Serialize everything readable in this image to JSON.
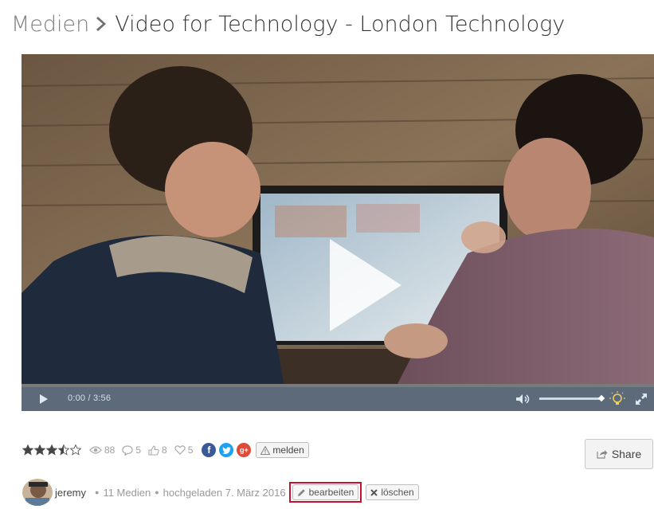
{
  "breadcrumb": {
    "parent": "Medien",
    "current": "Video for Technology - London Technology"
  },
  "player": {
    "time_display": "0:00 / 3:56",
    "progress": 0,
    "volume_level": 1.0
  },
  "stats": {
    "rating": 3.5,
    "rating_max": 5,
    "views": "88",
    "comments": "5",
    "likes": "8",
    "favorites": "5"
  },
  "social": {
    "facebook_glyph": "f",
    "twitter_glyph": "t",
    "googleplus_glyph": "g+",
    "colors": {
      "facebook": "#3b5998",
      "twitter": "#1da1f2",
      "googleplus": "#dd4b39"
    }
  },
  "actions": {
    "report_label": "melden",
    "share_label": "Share",
    "edit_label": "bearbeiten",
    "delete_label": "löschen"
  },
  "uploader": {
    "username": "jeremy",
    "media_count": "11 Medien",
    "uploaded": "hochgeladen 7. März 2016"
  },
  "colors": {
    "controls_bar": "#5d6a7a",
    "highlight_outline": "#c8102e"
  }
}
